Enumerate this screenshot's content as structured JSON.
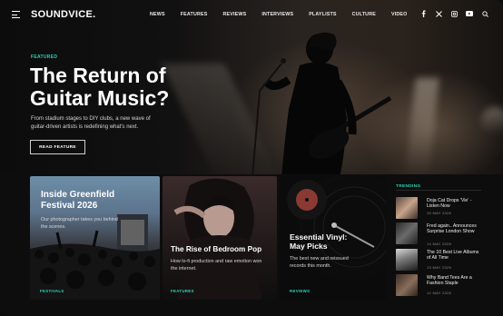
{
  "header": {
    "logo": "SOUNDVICE.",
    "nav": [
      "NEWS",
      "FEATURES",
      "REVIEWS",
      "INTERVIEWS",
      "PLAYLISTS",
      "CULTURE",
      "VIDEO"
    ],
    "social_icons": [
      "facebook-icon",
      "x-icon",
      "instagram-icon",
      "youtube-icon",
      "search-icon"
    ]
  },
  "hero": {
    "kicker": "FEATURED",
    "title": "The Return of Guitar Music?",
    "description": "From stadium stages to DIY clubs, a new wave of guitar-driven artists is redefining what's next.",
    "button": "READ FEATURE"
  },
  "cards": [
    {
      "title": "Inside Greenfield Festival 2026",
      "description": "Our photographer takes you behind the scenes.",
      "tag": "FESTIVALS"
    },
    {
      "title": "The Rise of Bedroom Pop",
      "description": "How lo-fi production and raw emotion won the internet.",
      "tag": "FEATURES"
    },
    {
      "title": "Essential Vinyl: May Picks",
      "description": "The best new and reissued records this month.",
      "tag": "REVIEWS"
    }
  ],
  "trending": {
    "label": "TRENDING",
    "items": [
      {
        "title": "Doja Cat Drops 'Vie' - Listen Now",
        "date": "15 MAY 2026"
      },
      {
        "title": "Fred again.. Announces Surprise London Show",
        "date": "14 MAY 2026"
      },
      {
        "title": "The 10 Best Live Albums of All Time",
        "date": "13 MAY 2026"
      },
      {
        "title": "Why Band Tees Are a Fashion Staple",
        "date": "12 MAY 2026"
      }
    ]
  },
  "colors": {
    "accent": "#2fd1b5",
    "background": "#0d0d0e"
  }
}
